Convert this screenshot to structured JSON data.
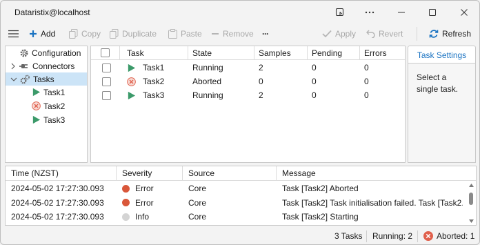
{
  "window": {
    "title": "Dataristix@localhost"
  },
  "toolbar": {
    "add": "Add",
    "copy": "Copy",
    "duplicate": "Duplicate",
    "paste": "Paste",
    "remove": "Remove",
    "more": "···",
    "apply": "Apply",
    "revert": "Revert",
    "refresh": "Refresh"
  },
  "tree": {
    "configuration": "Configuration",
    "connectors": "Connectors",
    "tasks": "Tasks",
    "children": [
      {
        "label": "Task1",
        "status": "running"
      },
      {
        "label": "Task2",
        "status": "aborted"
      },
      {
        "label": "Task3",
        "status": "running"
      }
    ]
  },
  "grid": {
    "columns": [
      "Task",
      "State",
      "Samples",
      "Pending",
      "Errors"
    ],
    "rows": [
      {
        "task": "Task1",
        "status": "running",
        "state": "Running",
        "samples": "2",
        "pending": "0",
        "errors": "0"
      },
      {
        "task": "Task2",
        "status": "aborted",
        "state": "Aborted",
        "samples": "0",
        "pending": "0",
        "errors": "0"
      },
      {
        "task": "Task3",
        "status": "running",
        "state": "Running",
        "samples": "2",
        "pending": "0",
        "errors": "0"
      }
    ]
  },
  "side_panel": {
    "tab": "Task Settings",
    "message": "Select a single task."
  },
  "log": {
    "columns": [
      "Time (NZST)",
      "Severity",
      "Source",
      "Message"
    ],
    "rows": [
      {
        "time": "2024-05-02 17:27:30.093",
        "severity": "Error",
        "source": "Core",
        "message": "Task [Task2] Aborted"
      },
      {
        "time": "2024-05-02 17:27:30.093",
        "severity": "Error",
        "source": "Core",
        "message": "Task [Task2] Task initialisation failed. Task [Task2..."
      },
      {
        "time": "2024-05-02 17:27:30.093",
        "severity": "Info",
        "source": "Core",
        "message": "Task [Task2] Starting"
      }
    ]
  },
  "status_bar": {
    "tasks": "3 Tasks",
    "running": "Running: 2",
    "aborted": "Aborted: 1"
  },
  "colors": {
    "accent": "#1a73c2",
    "running_green": "#3c9a6a",
    "error_dot": "#d9573a",
    "aborted_red": "#e0604c",
    "info_dot": "#d4d4d4",
    "selection": "#cce4f7"
  }
}
